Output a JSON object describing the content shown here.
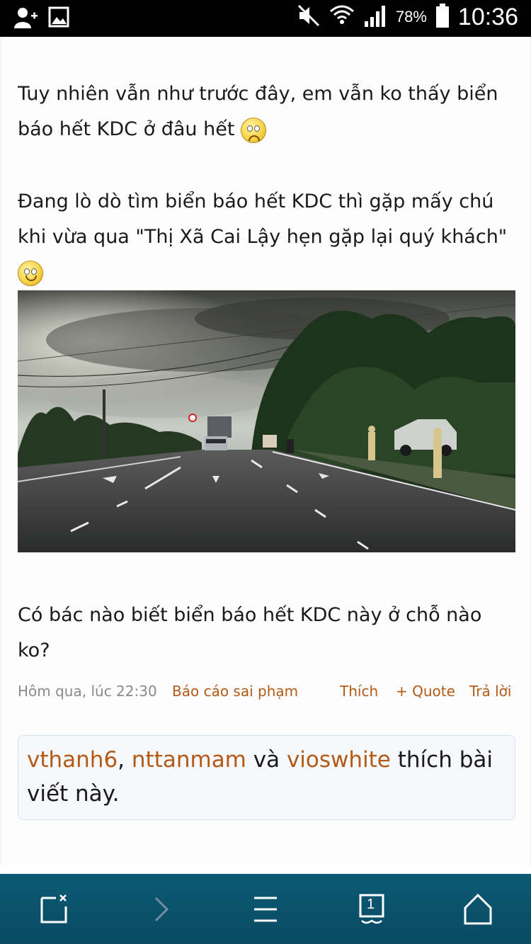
{
  "status_bar": {
    "battery_percent": "78%",
    "time": "10:36"
  },
  "post": {
    "para1": "Tuy nhiên vẫn như trước đây, em vẫn ko thấy biển báo hết KDC ở đâu hết",
    "para2": "Đang lò dò tìm biển báo hết KDC thì gặp mấy chú khi vừa qua \"Thị Xã Cai Lậy hẹn gặp lại quý khách\"",
    "para3": "Có bác nào biết biển báo hết KDC này ở chỗ nào ko?",
    "emoticon1": "sad-face-icon",
    "emoticon2": "smile-face-icon"
  },
  "meta": {
    "date": "Hôm qua, lúc 22:30",
    "report": "Báo cáo sai phạm",
    "like": "Thích",
    "quote": "+ Quote",
    "reply": "Trả lời"
  },
  "likes": {
    "user1": "vthanh6",
    "sep1": ", ",
    "user2": "nttanmam",
    "and": " và ",
    "user3": "vioswhite",
    "suffix": " thích bài viết này."
  },
  "bottom_nav": {
    "tabs_count": "1",
    "icons": [
      "close-tab-icon",
      "forward-icon",
      "menu-icon",
      "tabs-icon",
      "home-icon"
    ]
  },
  "colors": {
    "link": "#b35a16",
    "nav_bg": "#0c5a75",
    "meta_gray": "#8a8a8a"
  }
}
